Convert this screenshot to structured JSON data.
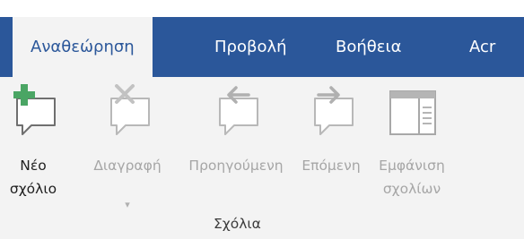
{
  "tabs": [
    {
      "label": "Αναθεώρηση",
      "active": true
    },
    {
      "label": "Προβολή",
      "active": false
    },
    {
      "label": "Βοήθεια",
      "active": false
    },
    {
      "label": "Acr",
      "active": false
    }
  ],
  "group": {
    "label": "Σχόλια",
    "commands": [
      {
        "line1": "Νέο",
        "line2": "σχόλιο",
        "enabled": true,
        "icon": "new-comment-icon"
      },
      {
        "line1": "Διαγραφή",
        "line2": "",
        "enabled": false,
        "icon": "delete-comment-icon",
        "dropdown": "▾"
      },
      {
        "line1": "Προηγούμενη",
        "line2": "",
        "enabled": false,
        "icon": "previous-comment-icon"
      },
      {
        "line1": "Επόμενη",
        "line2": "",
        "enabled": false,
        "icon": "next-comment-icon"
      },
      {
        "line1": "Εμφάνιση",
        "line2": "σχολίων",
        "enabled": false,
        "icon": "show-comments-icon"
      }
    ]
  },
  "colors": {
    "accent": "#2b579a",
    "ribbon": "#f3f3f3",
    "new_plus": "#4aa564",
    "disabled": "#a6a6a6"
  }
}
